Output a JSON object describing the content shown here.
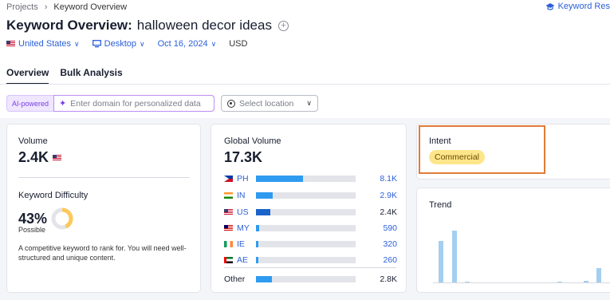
{
  "breadcrumb": {
    "items": [
      "Projects",
      "Keyword Overview"
    ]
  },
  "header_link": {
    "label": "Keyword Res"
  },
  "title": {
    "prefix": "Keyword Overview:",
    "keyword": "halloween decor ideas"
  },
  "filters": {
    "country": "United States",
    "device": "Desktop",
    "date": "Oct 16, 2024",
    "currency": "USD"
  },
  "tabs": [
    "Overview",
    "Bulk Analysis"
  ],
  "ai": {
    "badge": "AI-powered",
    "placeholder": "Enter domain for personalized data"
  },
  "location": {
    "placeholder": "Select location"
  },
  "volume": {
    "label": "Volume",
    "value": "2.4K"
  },
  "difficulty": {
    "label": "Keyword Difficulty",
    "value": "43%",
    "percent": 43,
    "level": "Possible",
    "description": "A competitive keyword to rank for. You will need well-structured and unique content."
  },
  "global_volume": {
    "label": "Global Volume",
    "value": "17.3K",
    "rows": [
      {
        "code": "PH",
        "value": "8.1K",
        "share": 0.47
      },
      {
        "code": "IN",
        "value": "2.9K",
        "share": 0.17
      },
      {
        "code": "US",
        "value": "2.4K",
        "share": 0.14
      },
      {
        "code": "MY",
        "value": "590",
        "share": 0.034
      },
      {
        "code": "IE",
        "value": "320",
        "share": 0.018
      },
      {
        "code": "AE",
        "value": "260",
        "share": 0.015
      }
    ],
    "other": {
      "label": "Other",
      "value": "2.8K",
      "share": 0.16
    }
  },
  "intent": {
    "label": "Intent",
    "value": "Commercial"
  },
  "trend": {
    "label": "Trend",
    "values": [
      0.62,
      0.78,
      0.02,
      0,
      0,
      0,
      0,
      0,
      0,
      0.02,
      0,
      0.03,
      0.22,
      0.28
    ]
  },
  "colors": {
    "accent": "#2b5fd9",
    "bar": "#2e9bf0",
    "trend": "#a4cfef",
    "intent_badge": "#fde68a",
    "difficulty": "#fcc95a",
    "highlight": "#e07b39"
  }
}
